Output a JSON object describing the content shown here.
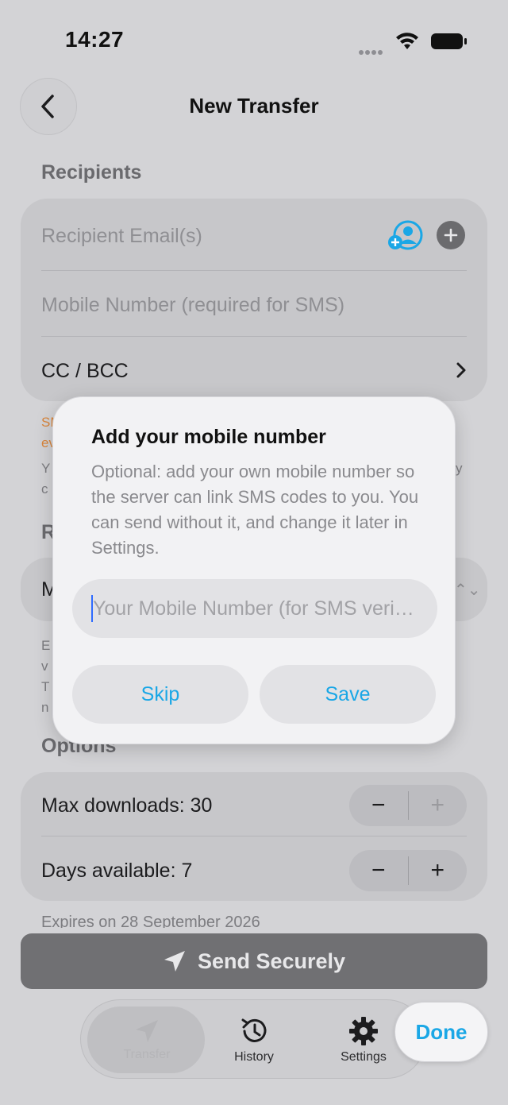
{
  "status_bar": {
    "time": "14:27"
  },
  "nav": {
    "title": "New Transfer"
  },
  "recipients": {
    "section_title": "Recipients",
    "email_placeholder": "Recipient Email(s)",
    "mobile_placeholder": "Mobile Number (required for SMS)",
    "cc_bcc_label": "CC / BCC"
  },
  "options": {
    "section_title": "Options",
    "max_downloads_label": "Max downloads: 30",
    "days_available_label": "Days available: 7",
    "expires_text": "Expires on 28 September 2026"
  },
  "send_button": {
    "label": "Send Securely"
  },
  "tabbar": {
    "tabs": [
      {
        "label": "Transfer",
        "icon": "paper-plane-icon"
      },
      {
        "label": "History",
        "icon": "clock-history-icon"
      },
      {
        "label": "Settings",
        "icon": "gear-icon"
      }
    ],
    "done_label": "Done"
  },
  "modal": {
    "title": "Add your mobile number",
    "body": "Optional: add your own mobile number so the server can link SMS codes to you. You can send without it, and change it later in Settings.",
    "input_placeholder": "Your Mobile Number (for SMS verification)",
    "skip_label": "Skip",
    "save_label": "Save"
  },
  "colors": {
    "accent": "#1aa7e6",
    "warning": "#d9853b",
    "dim_background": "#d3d3d6"
  }
}
